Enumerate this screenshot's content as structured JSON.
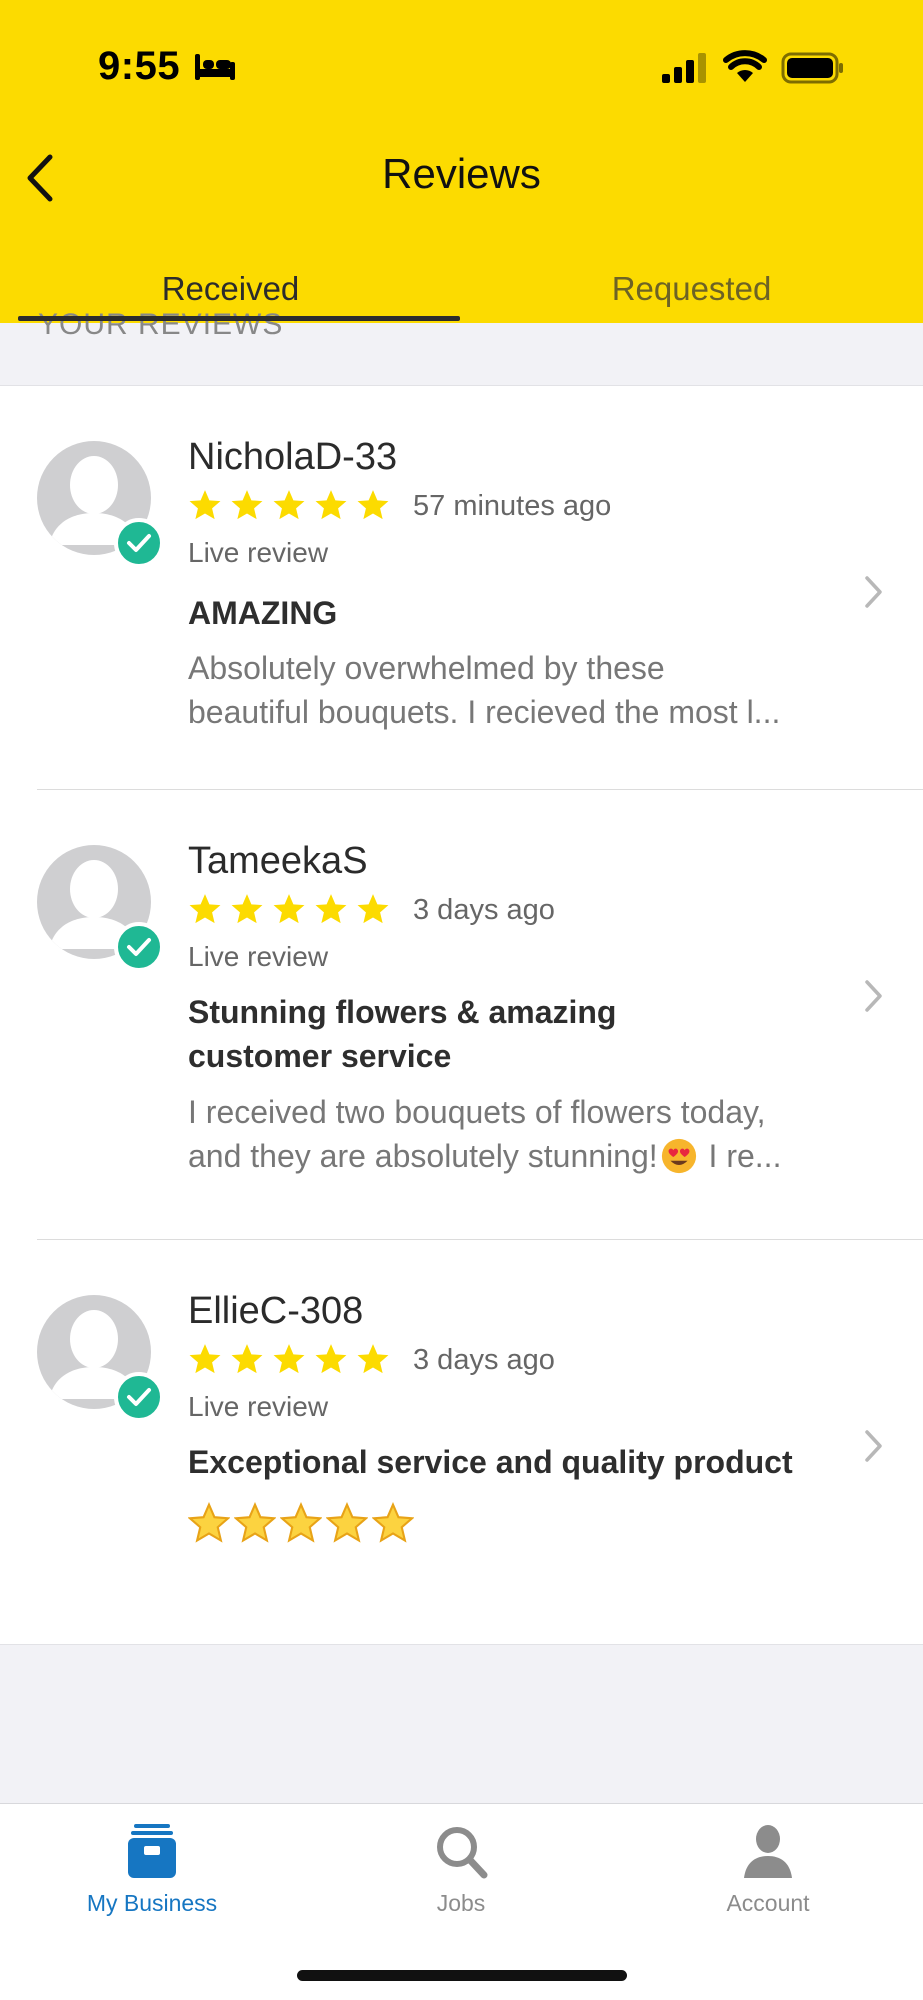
{
  "status_bar": {
    "time": "9:55"
  },
  "header": {
    "title": "Reviews",
    "back_label": "Back"
  },
  "tabs": [
    {
      "label": "Received",
      "active": true
    },
    {
      "label": "Requested",
      "active": false
    }
  ],
  "section_label": "YOUR REVIEWS",
  "reviews": [
    {
      "name": "NicholaD-33",
      "rating": 5,
      "time_ago": "57 minutes ago",
      "status": "Live review",
      "title_lines": [
        "AMAZING"
      ],
      "body_lines": [
        "Absolutely overwhelmed by these",
        "beautiful bouquets. I recieved the most l..."
      ]
    },
    {
      "name": "TameekaS",
      "rating": 5,
      "time_ago": "3 days ago",
      "status": "Live review",
      "title_lines": [
        "Stunning flowers & amazing",
        "customer service"
      ],
      "body_lines": [
        "I received two bouquets of flowers today,",
        "and they are absolutely stunning!",
        " I re..."
      ]
    },
    {
      "name": "EllieC-308",
      "rating": 5,
      "time_ago": "3 days ago",
      "status": "Live review",
      "title_lines": [
        "Exceptional service and quality product"
      ],
      "body_emoji_stars": 5
    }
  ],
  "tab_bar": [
    {
      "label": "My Business",
      "icon": "briefcase-icon",
      "active": true
    },
    {
      "label": "Jobs",
      "icon": "search-icon",
      "active": false
    },
    {
      "label": "Account",
      "icon": "person-icon",
      "active": false
    }
  ],
  "colors": {
    "header_bg": "#fcdb00",
    "star": "#fcdb00",
    "verified": "#1fb894",
    "active_tab_bar": "#1676c2"
  }
}
